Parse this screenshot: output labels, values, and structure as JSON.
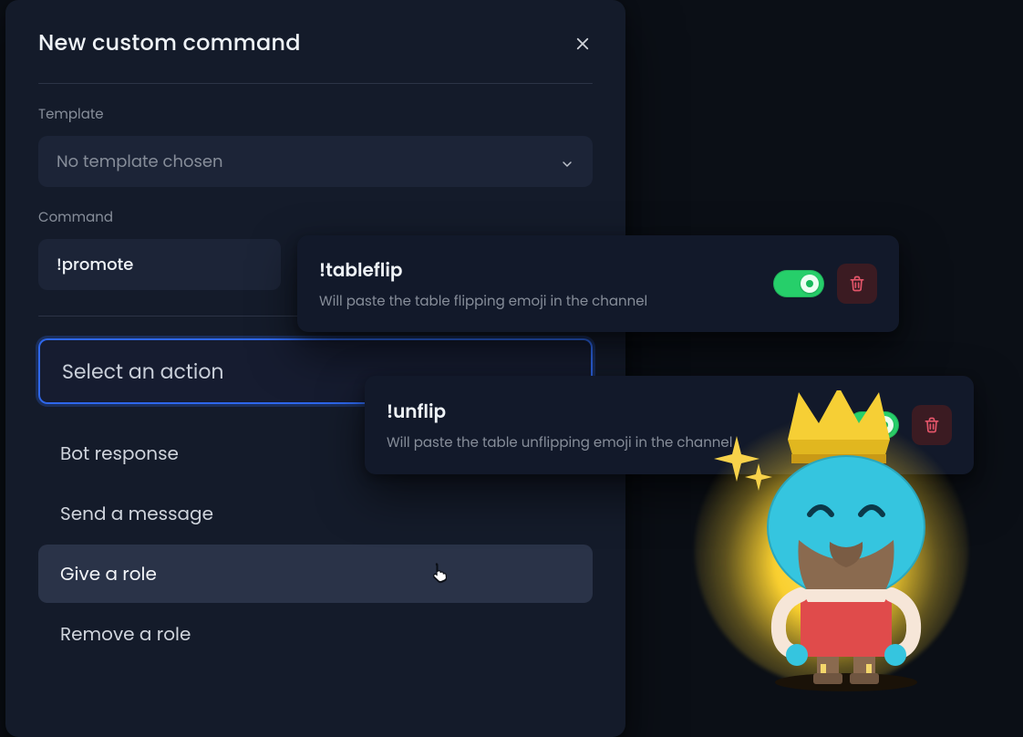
{
  "modal": {
    "title": "New custom command",
    "template_label": "Template",
    "template_placeholder": "No template chosen",
    "command_label": "Command",
    "command_value": "!promote",
    "action_placeholder": "Select an action",
    "actions": [
      "Bot response",
      "Send a message",
      "Give a role",
      "Remove a role"
    ],
    "hover_index": 2
  },
  "cards": [
    {
      "name": "!tableflip",
      "desc": "Will paste the table flipping emoji in the channel",
      "enabled": true
    },
    {
      "name": "!unflip",
      "desc": "Will paste the table unflipping emoji in the channel",
      "enabled": true
    }
  ],
  "icons": {
    "close": "close-icon",
    "chevron_down": "chevron-down-icon",
    "trash": "trash-icon"
  }
}
